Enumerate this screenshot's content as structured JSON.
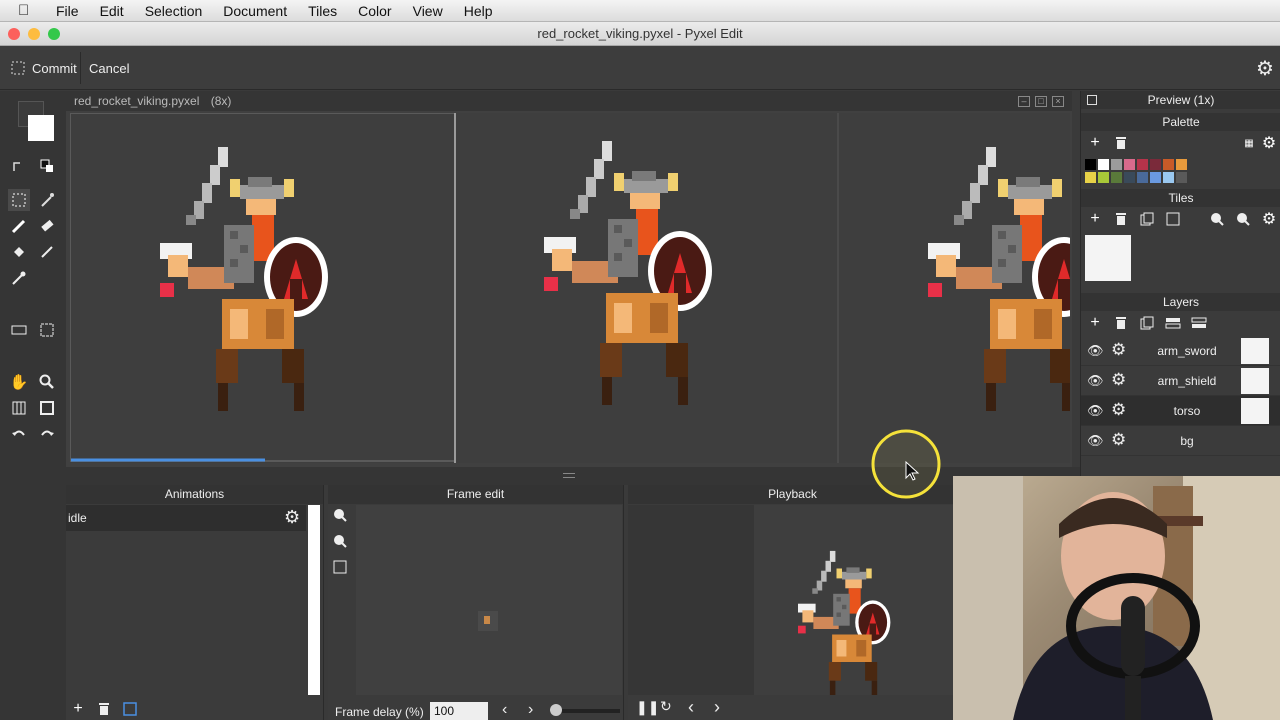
{
  "menubar": {
    "items": [
      "File",
      "Edit",
      "Selection",
      "Document",
      "Tiles",
      "Color",
      "View",
      "Help"
    ]
  },
  "window": {
    "title": "red_rocket_viking.pyxel - Pyxel Edit"
  },
  "toolbar": {
    "commit_label": "Commit",
    "cancel_label": "Cancel"
  },
  "document": {
    "tab_title": "red_rocket_viking.pyxel",
    "zoom": "(8x)"
  },
  "right_panels": {
    "preview_title": "Preview (1x)",
    "palette_title": "Palette",
    "tiles_title": "Tiles",
    "layers_title": "Layers",
    "palette_colors": [
      "#000000",
      "#ffffff",
      "#9c9c9c",
      "#d86a8c",
      "#b5334a",
      "#7a2a3a",
      "#c85a28",
      "#e89a3c",
      "#e8d248",
      "#a8c838",
      "#5a7a3a",
      "#3a4a5a",
      "#4a6a9a",
      "#6a9ae0",
      "#9ac8f0",
      "#5a5a5a"
    ],
    "layers": [
      {
        "name": "arm_sword"
      },
      {
        "name": "arm_shield"
      },
      {
        "name": "torso"
      },
      {
        "name": "bg"
      }
    ]
  },
  "animations": {
    "title": "Animations",
    "items": [
      {
        "name": "idle"
      }
    ]
  },
  "frame_edit": {
    "title": "Frame edit",
    "delay_label": "Frame delay (%)",
    "delay_value": "100"
  },
  "playback": {
    "title": "Playback"
  },
  "colors": {
    "accent": "#4a90e2"
  }
}
